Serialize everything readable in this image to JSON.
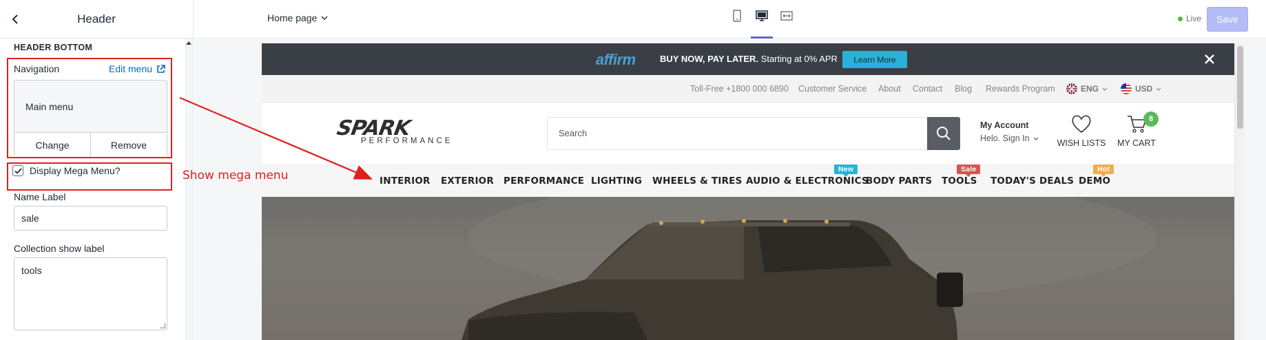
{
  "sidebar": {
    "title": "Header",
    "section_heading": "HEADER BOTTOM",
    "navigation_label": "Navigation",
    "edit_menu": "Edit menu",
    "menu_name": "Main menu",
    "change_label": "Change",
    "remove_label": "Remove",
    "mega_menu_label": "Display Mega Menu?",
    "mega_menu_checked": true,
    "name_label": "Name Label",
    "name_value": "sale",
    "collection_label": "Collection show label",
    "collection_value": "tools"
  },
  "annotation": {
    "text": "Show mega menu",
    "color": "#e02020"
  },
  "topbar": {
    "page_select": "Home page",
    "live_label": "Live",
    "save_label": "Save"
  },
  "promo": {
    "brand": "affirm",
    "headline": "BUY NOW, PAY LATER.",
    "subtext": "Starting at 0% APR",
    "button": "Learn More"
  },
  "utility": {
    "phone": "Toll-Free +1800 000 6890",
    "links": [
      "Customer Service",
      "About",
      "Contact",
      "Blog",
      "Rewards Program"
    ],
    "language": "ENG",
    "currency": "USD"
  },
  "store": {
    "logo_main": "SPARK",
    "logo_sub": "PERFORMANCE",
    "search_placeholder": "Search",
    "account_title": "My Account",
    "account_sub": "Helo. Sign In",
    "wishlist_label": "WISH LISTS",
    "cart_label": "MY CART",
    "cart_count": "8"
  },
  "nav": {
    "items": [
      "INTERIOR",
      "EXTERIOR",
      "PERFORMANCE",
      "LIGHTING",
      "WHEELS & TIRES",
      "AUDIO & ELECTRONICS",
      "BODY PARTS",
      "TOOLS",
      "TODAY'S DEALS",
      "DEMO"
    ],
    "tags": {
      "new": {
        "label": "New",
        "color": "#2ab1d9"
      },
      "sale": {
        "label": "Sale",
        "color": "#d9534f"
      },
      "hot": {
        "label": "Hot",
        "color": "#f0ad4e"
      }
    }
  },
  "colors": {
    "accent": "#5c6ac4",
    "promo_bg": "#3a3f45",
    "annotation_red": "#e02020"
  }
}
